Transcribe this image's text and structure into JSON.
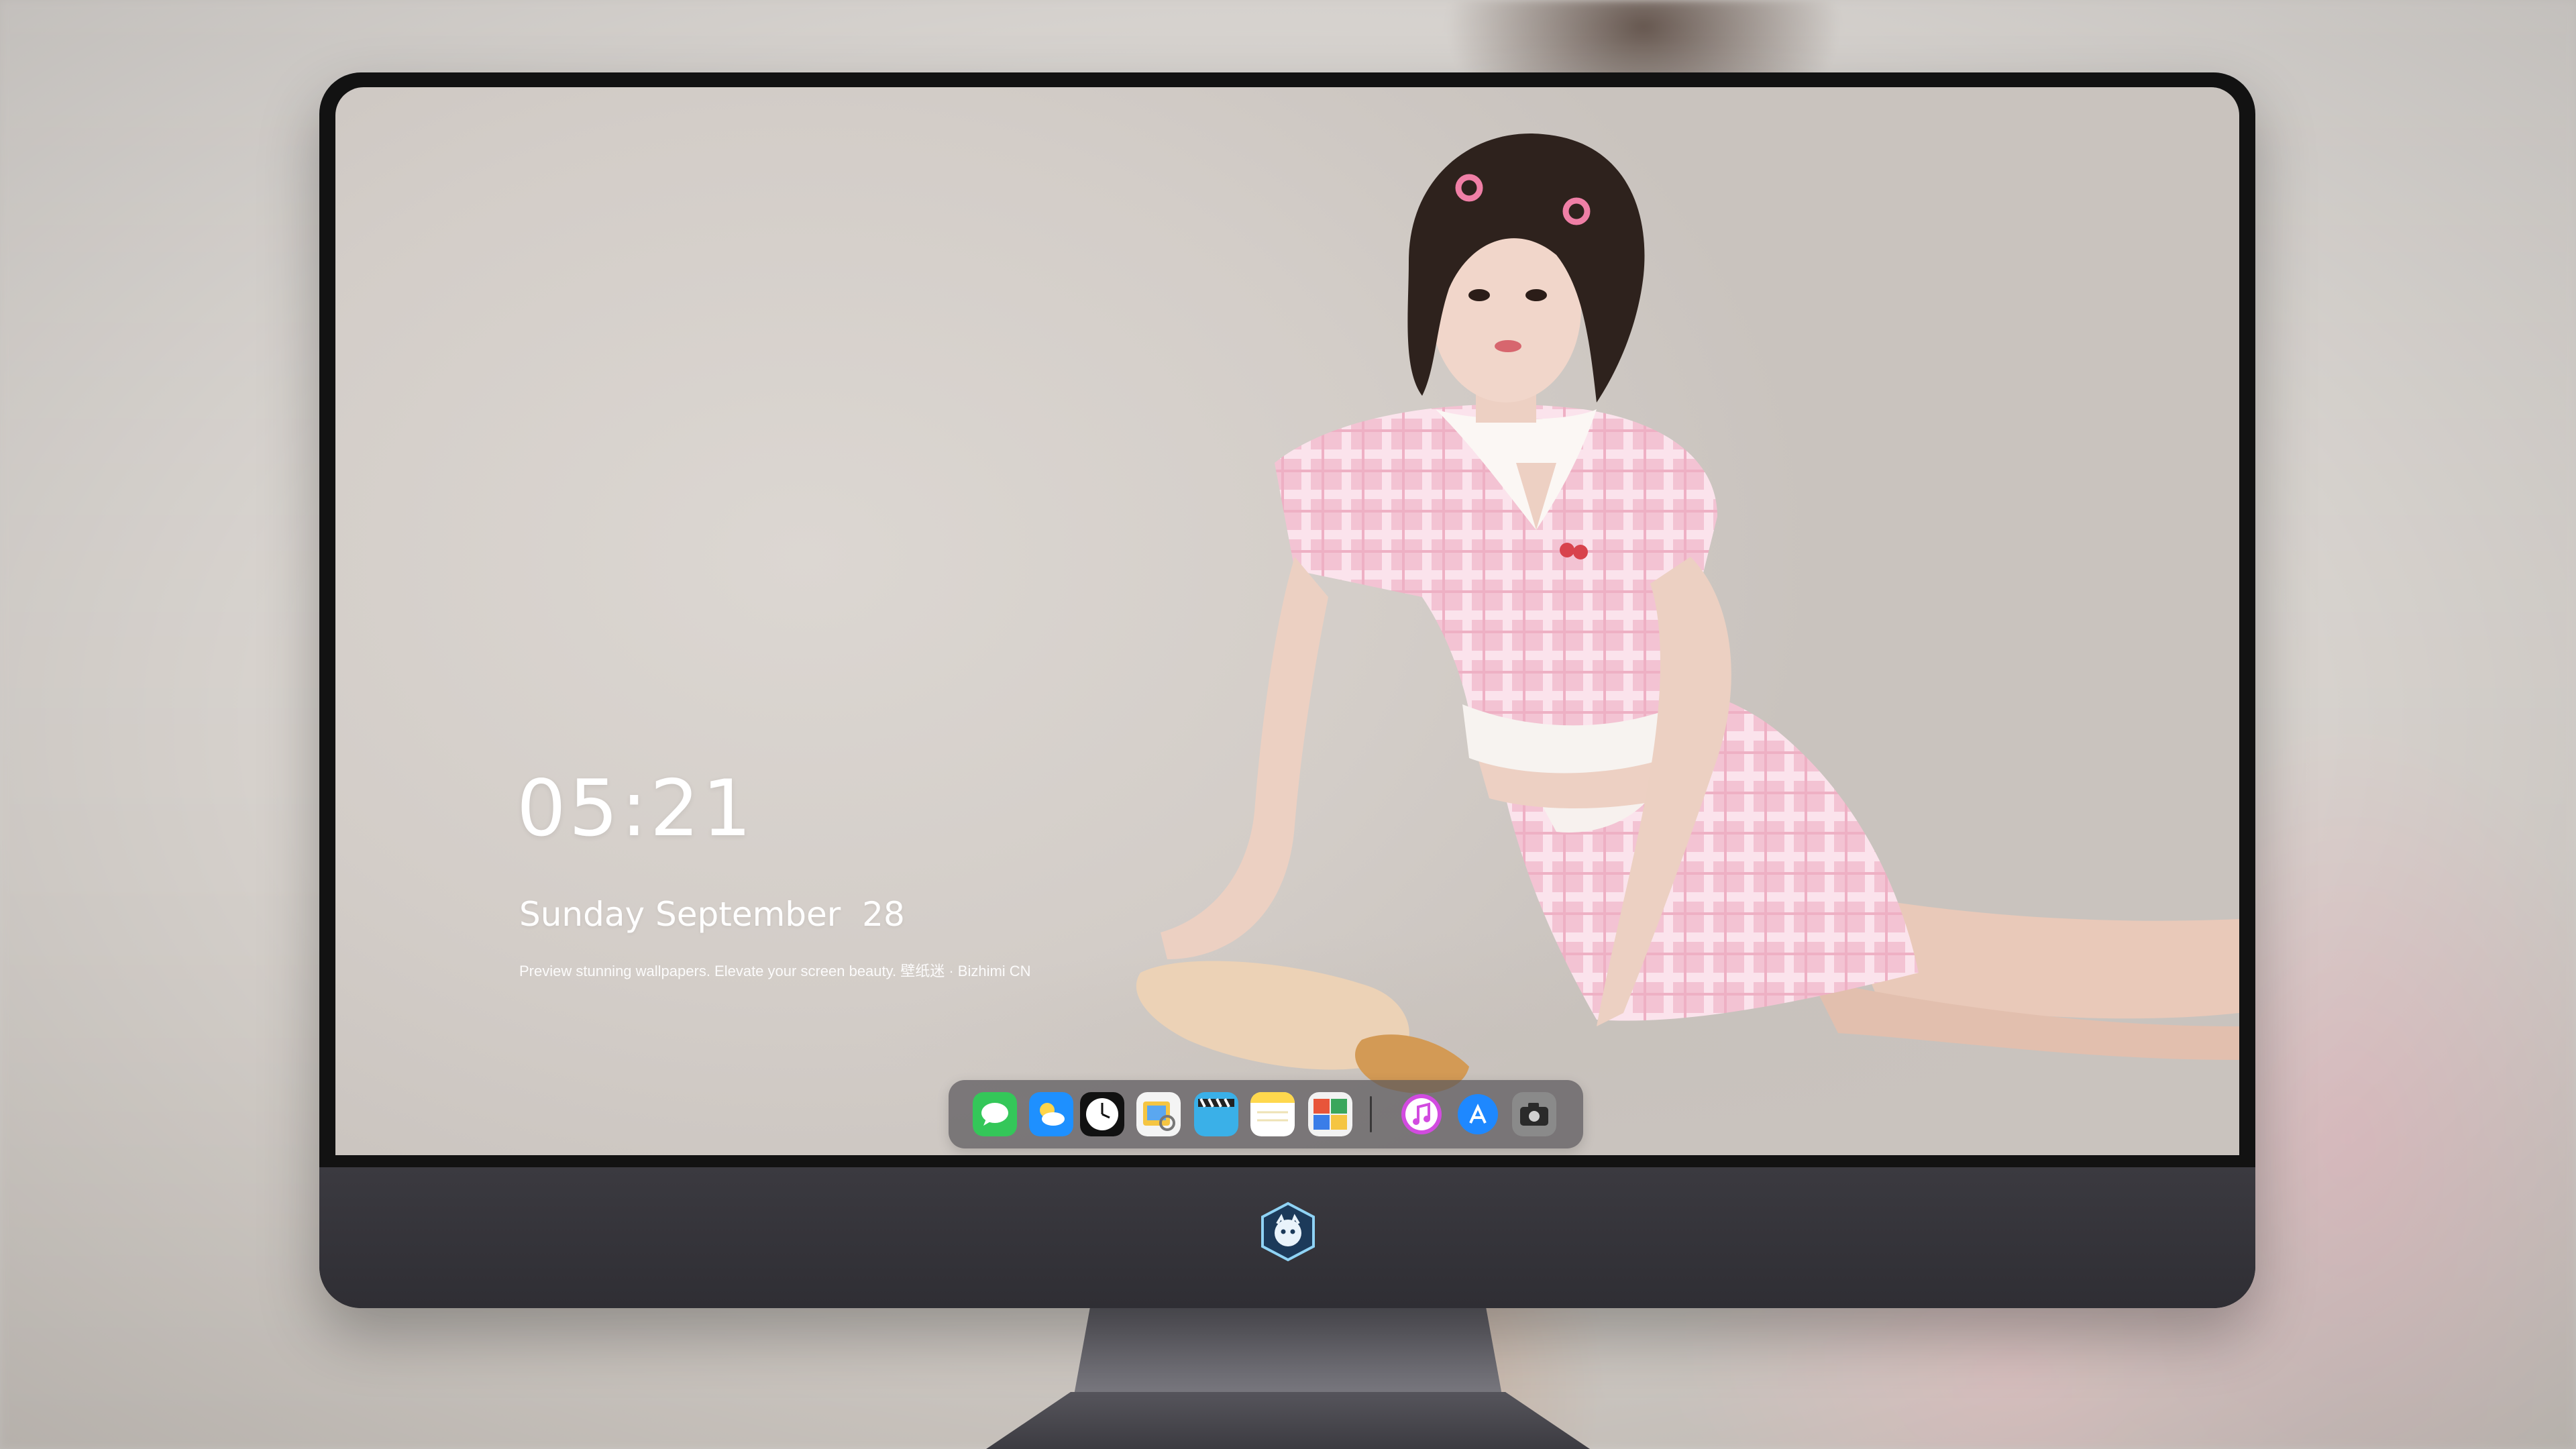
{
  "lockscreen": {
    "time": "05:21",
    "date": "Sunday September  28",
    "caption": "Preview stunning wallpapers. Elevate your screen beauty. 壁纸迷 · Bizhimi CN"
  },
  "dock": {
    "apps": [
      {
        "name": "messages-icon",
        "color": "#34c759"
      },
      {
        "name": "weather-icon",
        "color": "#1e90ff"
      },
      {
        "name": "clock-icon",
        "color": "#111111"
      },
      {
        "name": "preview-icon",
        "color": "#f5c542"
      },
      {
        "name": "clips-icon",
        "color": "#3ab0e8"
      },
      {
        "name": "notes-icon",
        "color": "#ffd84d"
      },
      {
        "name": "photo-booth-icon",
        "color": "#e8553a"
      },
      {
        "name": "itunes-icon",
        "color": "#d24be0"
      },
      {
        "name": "app-store-icon",
        "color": "#1e88ff"
      },
      {
        "name": "camera-icon",
        "color": "#8a8a8a"
      }
    ]
  },
  "colors": {
    "wallpaper_bg": "#d3cdc8",
    "outfit_pink": "#f2bfd0",
    "bezel": "#121212",
    "chin": "#35343a"
  }
}
